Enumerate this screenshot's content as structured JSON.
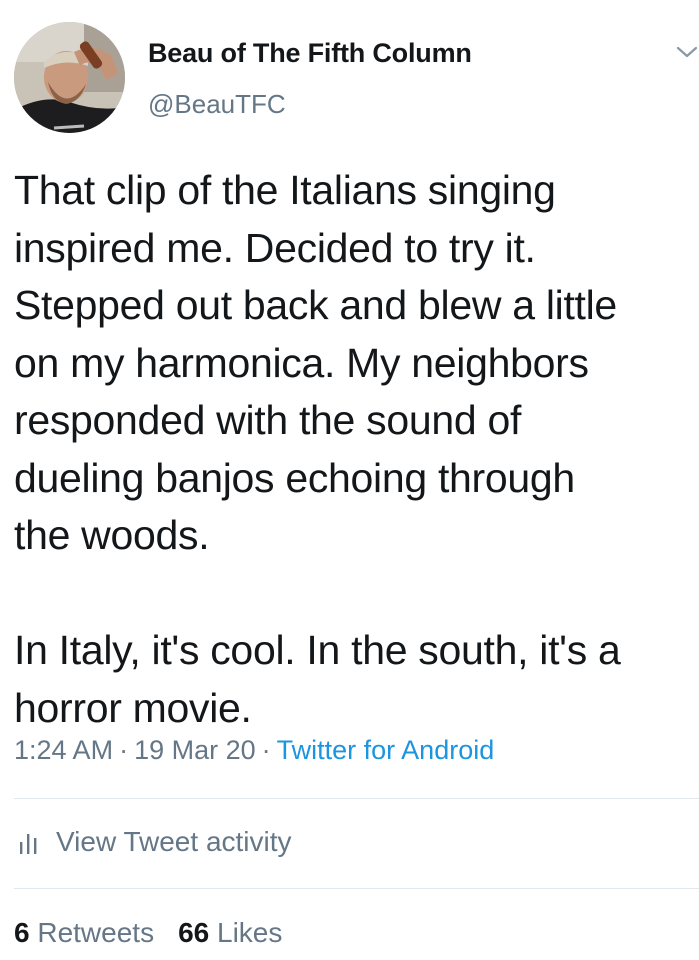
{
  "author": {
    "display_name": "Beau of The Fifth Column",
    "handle": "@BeauTFC"
  },
  "tweet": {
    "text": "That clip of the Italians singing\ninspired me. Decided to try it.\nStepped out back and blew a little\non my harmonica. My neighbors\nresponded with the sound of\ndueling banjos echoing through\nthe woods.\n\nIn Italy, it's cool. In the south, it's a\nhorror movie.",
    "time": "1:24 AM",
    "date": "19 Mar 20",
    "source": "Twitter for Android",
    "separator": "·"
  },
  "activity": {
    "label": "View Tweet activity",
    "icon": "bar-chart-icon"
  },
  "stats": {
    "retweets_count": "6",
    "retweets_label": "Retweets",
    "likes_count": "66",
    "likes_label": "Likes"
  },
  "icons": {
    "menu": "chevron-down-icon"
  },
  "colors": {
    "primary_text": "#14171a",
    "secondary_text": "#657786",
    "link": "#1b95e0",
    "divider": "#e1e8ed"
  }
}
